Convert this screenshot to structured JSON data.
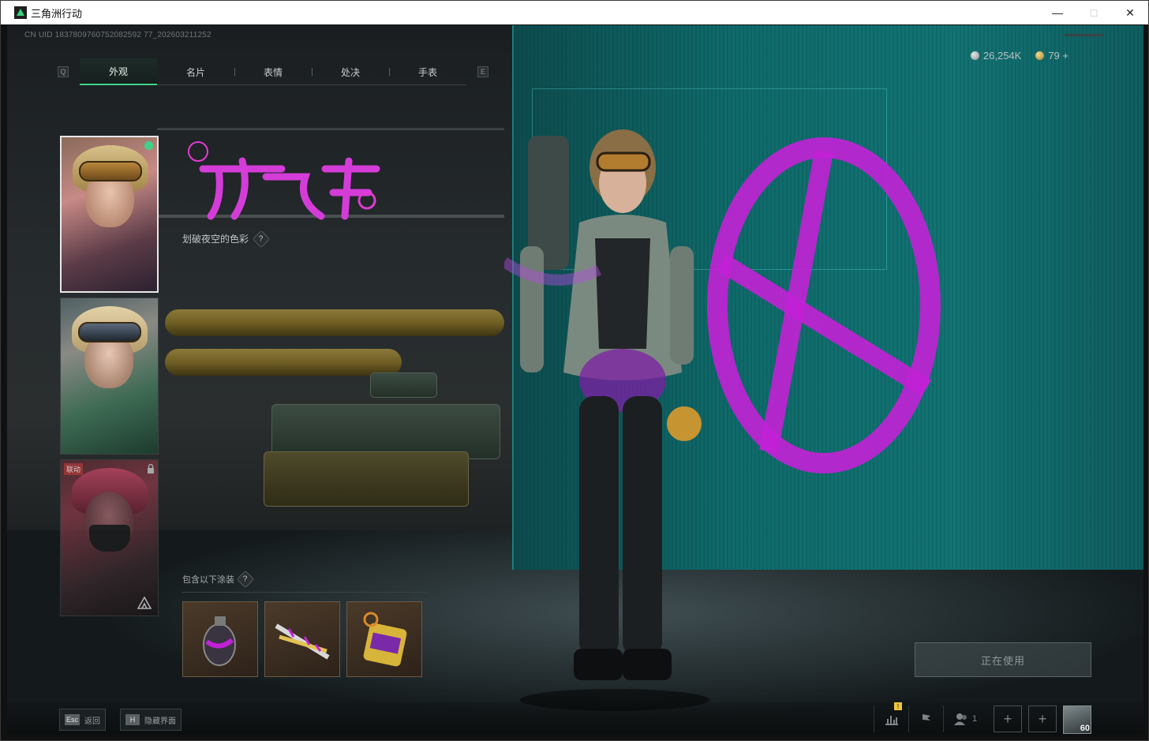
{
  "window": {
    "title": "三角洲行动",
    "controls": [
      "—",
      "□",
      "✕"
    ]
  },
  "uid": "CN UID 1837809760752082592 77_202603211252",
  "tabs": {
    "left_key": "Q",
    "right_key": "E",
    "items": [
      {
        "label": "外观",
        "active": true
      },
      {
        "label": "名片",
        "active": false
      },
      {
        "label": "表情",
        "active": false
      },
      {
        "label": "处决",
        "active": false
      },
      {
        "label": "手表",
        "active": false
      }
    ]
  },
  "currency": [
    {
      "icon": "silver-coin-icon",
      "value": "26,254K"
    },
    {
      "icon": "gold-coin-icon",
      "value": "79 +"
    }
  ],
  "skin": {
    "title_graphic": "不羁人生",
    "subtitle": "划破夜空的色彩",
    "help": "?"
  },
  "character_cards": [
    {
      "name": "card-1",
      "selected": true,
      "online": true
    },
    {
      "name": "card-2",
      "selected": false
    },
    {
      "name": "card-3",
      "selected": false,
      "tag": "联动",
      "locked": true
    }
  ],
  "includes": {
    "label": "包含以下涂装",
    "help": "?",
    "items": [
      "grenade-skin",
      "knife-skin",
      "device-skin"
    ]
  },
  "action_button": "正在使用",
  "bottom_hints": [
    {
      "key": "Esc",
      "label": "返回"
    },
    {
      "key": "H",
      "label": "隐藏界面"
    }
  ],
  "bottom_right": {
    "badge": "!",
    "friends_count": "1",
    "avatar_level": "60"
  },
  "colors": {
    "accent": "#3fd389",
    "spray": "#c321d6",
    "screen": "#0f6a6a"
  }
}
